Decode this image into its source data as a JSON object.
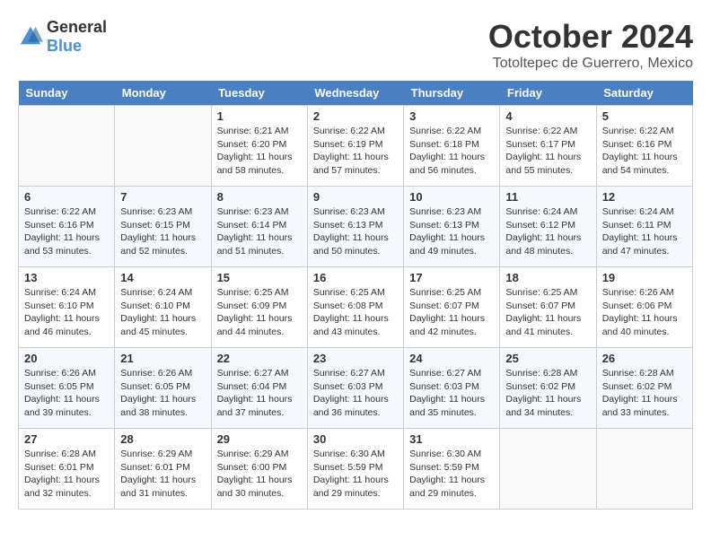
{
  "header": {
    "logo": {
      "general": "General",
      "blue": "Blue"
    },
    "month": "October 2024",
    "location": "Totoltepec de Guerrero, Mexico"
  },
  "weekdays": [
    "Sunday",
    "Monday",
    "Tuesday",
    "Wednesday",
    "Thursday",
    "Friday",
    "Saturday"
  ],
  "weeks": [
    [
      null,
      null,
      {
        "day": 1,
        "sunrise": "Sunrise: 6:21 AM",
        "sunset": "Sunset: 6:20 PM",
        "daylight": "Daylight: 11 hours and 58 minutes."
      },
      {
        "day": 2,
        "sunrise": "Sunrise: 6:22 AM",
        "sunset": "Sunset: 6:19 PM",
        "daylight": "Daylight: 11 hours and 57 minutes."
      },
      {
        "day": 3,
        "sunrise": "Sunrise: 6:22 AM",
        "sunset": "Sunset: 6:18 PM",
        "daylight": "Daylight: 11 hours and 56 minutes."
      },
      {
        "day": 4,
        "sunrise": "Sunrise: 6:22 AM",
        "sunset": "Sunset: 6:17 PM",
        "daylight": "Daylight: 11 hours and 55 minutes."
      },
      {
        "day": 5,
        "sunrise": "Sunrise: 6:22 AM",
        "sunset": "Sunset: 6:16 PM",
        "daylight": "Daylight: 11 hours and 54 minutes."
      }
    ],
    [
      {
        "day": 6,
        "sunrise": "Sunrise: 6:22 AM",
        "sunset": "Sunset: 6:16 PM",
        "daylight": "Daylight: 11 hours and 53 minutes."
      },
      {
        "day": 7,
        "sunrise": "Sunrise: 6:23 AM",
        "sunset": "Sunset: 6:15 PM",
        "daylight": "Daylight: 11 hours and 52 minutes."
      },
      {
        "day": 8,
        "sunrise": "Sunrise: 6:23 AM",
        "sunset": "Sunset: 6:14 PM",
        "daylight": "Daylight: 11 hours and 51 minutes."
      },
      {
        "day": 9,
        "sunrise": "Sunrise: 6:23 AM",
        "sunset": "Sunset: 6:13 PM",
        "daylight": "Daylight: 11 hours and 50 minutes."
      },
      {
        "day": 10,
        "sunrise": "Sunrise: 6:23 AM",
        "sunset": "Sunset: 6:13 PM",
        "daylight": "Daylight: 11 hours and 49 minutes."
      },
      {
        "day": 11,
        "sunrise": "Sunrise: 6:24 AM",
        "sunset": "Sunset: 6:12 PM",
        "daylight": "Daylight: 11 hours and 48 minutes."
      },
      {
        "day": 12,
        "sunrise": "Sunrise: 6:24 AM",
        "sunset": "Sunset: 6:11 PM",
        "daylight": "Daylight: 11 hours and 47 minutes."
      }
    ],
    [
      {
        "day": 13,
        "sunrise": "Sunrise: 6:24 AM",
        "sunset": "Sunset: 6:10 PM",
        "daylight": "Daylight: 11 hours and 46 minutes."
      },
      {
        "day": 14,
        "sunrise": "Sunrise: 6:24 AM",
        "sunset": "Sunset: 6:10 PM",
        "daylight": "Daylight: 11 hours and 45 minutes."
      },
      {
        "day": 15,
        "sunrise": "Sunrise: 6:25 AM",
        "sunset": "Sunset: 6:09 PM",
        "daylight": "Daylight: 11 hours and 44 minutes."
      },
      {
        "day": 16,
        "sunrise": "Sunrise: 6:25 AM",
        "sunset": "Sunset: 6:08 PM",
        "daylight": "Daylight: 11 hours and 43 minutes."
      },
      {
        "day": 17,
        "sunrise": "Sunrise: 6:25 AM",
        "sunset": "Sunset: 6:07 PM",
        "daylight": "Daylight: 11 hours and 42 minutes."
      },
      {
        "day": 18,
        "sunrise": "Sunrise: 6:25 AM",
        "sunset": "Sunset: 6:07 PM",
        "daylight": "Daylight: 11 hours and 41 minutes."
      },
      {
        "day": 19,
        "sunrise": "Sunrise: 6:26 AM",
        "sunset": "Sunset: 6:06 PM",
        "daylight": "Daylight: 11 hours and 40 minutes."
      }
    ],
    [
      {
        "day": 20,
        "sunrise": "Sunrise: 6:26 AM",
        "sunset": "Sunset: 6:05 PM",
        "daylight": "Daylight: 11 hours and 39 minutes."
      },
      {
        "day": 21,
        "sunrise": "Sunrise: 6:26 AM",
        "sunset": "Sunset: 6:05 PM",
        "daylight": "Daylight: 11 hours and 38 minutes."
      },
      {
        "day": 22,
        "sunrise": "Sunrise: 6:27 AM",
        "sunset": "Sunset: 6:04 PM",
        "daylight": "Daylight: 11 hours and 37 minutes."
      },
      {
        "day": 23,
        "sunrise": "Sunrise: 6:27 AM",
        "sunset": "Sunset: 6:03 PM",
        "daylight": "Daylight: 11 hours and 36 minutes."
      },
      {
        "day": 24,
        "sunrise": "Sunrise: 6:27 AM",
        "sunset": "Sunset: 6:03 PM",
        "daylight": "Daylight: 11 hours and 35 minutes."
      },
      {
        "day": 25,
        "sunrise": "Sunrise: 6:28 AM",
        "sunset": "Sunset: 6:02 PM",
        "daylight": "Daylight: 11 hours and 34 minutes."
      },
      {
        "day": 26,
        "sunrise": "Sunrise: 6:28 AM",
        "sunset": "Sunset: 6:02 PM",
        "daylight": "Daylight: 11 hours and 33 minutes."
      }
    ],
    [
      {
        "day": 27,
        "sunrise": "Sunrise: 6:28 AM",
        "sunset": "Sunset: 6:01 PM",
        "daylight": "Daylight: 11 hours and 32 minutes."
      },
      {
        "day": 28,
        "sunrise": "Sunrise: 6:29 AM",
        "sunset": "Sunset: 6:01 PM",
        "daylight": "Daylight: 11 hours and 31 minutes."
      },
      {
        "day": 29,
        "sunrise": "Sunrise: 6:29 AM",
        "sunset": "Sunset: 6:00 PM",
        "daylight": "Daylight: 11 hours and 30 minutes."
      },
      {
        "day": 30,
        "sunrise": "Sunrise: 6:30 AM",
        "sunset": "Sunset: 5:59 PM",
        "daylight": "Daylight: 11 hours and 29 minutes."
      },
      {
        "day": 31,
        "sunrise": "Sunrise: 6:30 AM",
        "sunset": "Sunset: 5:59 PM",
        "daylight": "Daylight: 11 hours and 29 minutes."
      },
      null,
      null
    ]
  ]
}
